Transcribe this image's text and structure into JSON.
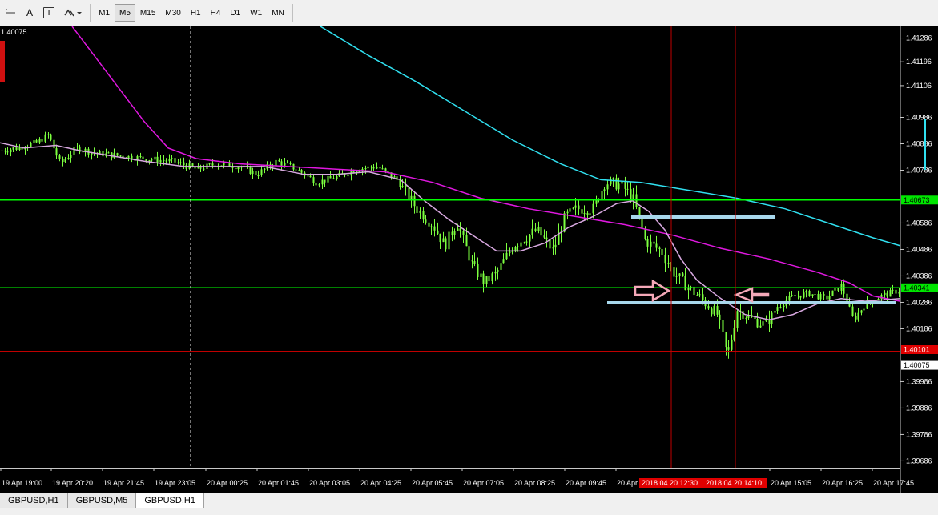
{
  "toolbar": {
    "text_tool": "A",
    "text_label_tool": "T",
    "timeframes": [
      {
        "label": "M1",
        "active": false
      },
      {
        "label": "M5",
        "active": true
      },
      {
        "label": "M15",
        "active": false
      },
      {
        "label": "M30",
        "active": false
      },
      {
        "label": "H1",
        "active": false
      },
      {
        "label": "H4",
        "active": false
      },
      {
        "label": "D1",
        "active": false
      },
      {
        "label": "W1",
        "active": false
      },
      {
        "label": "MN",
        "active": false
      }
    ]
  },
  "chart": {
    "corner_price": "1.40075",
    "price_ticks": [
      "1.41286",
      "1.41196",
      "1.41106",
      "1.40986",
      "1.40886",
      "1.40786",
      "1.40586",
      "1.40486",
      "1.40386",
      "1.40286",
      "1.40186",
      "1.39986",
      "1.39886",
      "1.39786",
      "1.39686"
    ],
    "price_range": [
      1.3966,
      1.4133
    ],
    "price_scale_labels": {
      "upper_level": "1.40673",
      "lower_level": "1.40341",
      "red_level": "1.40101",
      "current": "1.40075"
    },
    "time_labels": [
      "19 Apr 19:00",
      "19 Apr 20:20",
      "19 Apr 21:45",
      "19 Apr 23:05",
      "20 Apr 00:25",
      "20 Apr 01:45",
      "20 Apr 03:05",
      "20 Apr 04:25",
      "20 Apr 05:45",
      "20 Apr 07:05",
      "20 Apr 08:25",
      "20 Apr 09:45",
      "20 Apr",
      "20 Apr 15:05",
      "20 Apr 16:25",
      "20 Apr 17:45"
    ],
    "vertical_line_labels": [
      "2018.04.20 12:30",
      "2018.04.20 14:10"
    ],
    "colors": {
      "background": "#000000",
      "candles": "#7cff3f",
      "horizontal_levels": "#00ff00",
      "red_level": "#c00000",
      "vertical_lines": "#c00000",
      "ma_fast": "#d8a8e0",
      "ma_mid": "#e018e0",
      "ma_slow": "#30e0f0",
      "drawn_levels": "#a8d8ec",
      "arrows": "#f4a8b8"
    }
  },
  "tabs": [
    {
      "label": "GBPUSD,H1",
      "active": false
    },
    {
      "label": "GBPUSD,M5",
      "active": false
    },
    {
      "label": "GBPUSD,H1",
      "active": true
    }
  ]
}
